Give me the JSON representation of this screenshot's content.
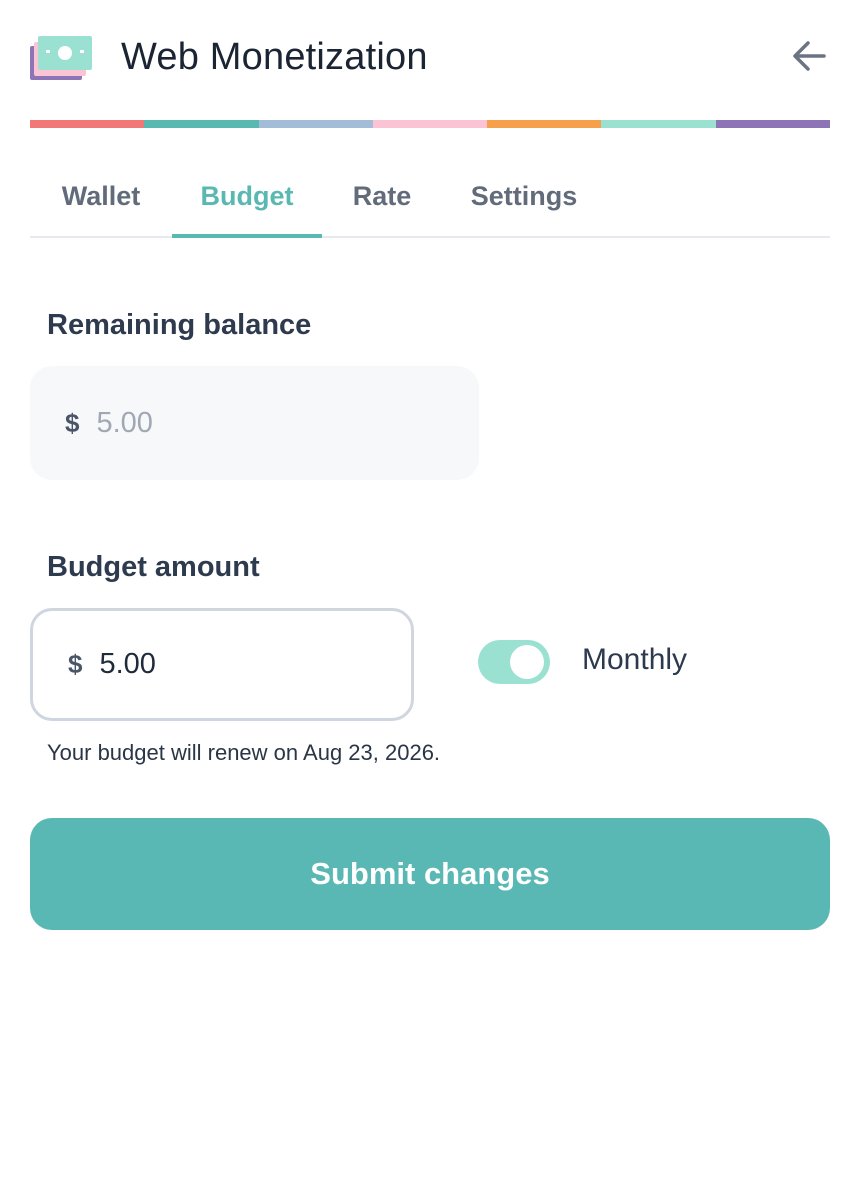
{
  "app": {
    "title": "Web Monetization",
    "logo_icon": "money-bill-icon",
    "back_icon": "arrow-left-icon"
  },
  "stripe_colors": [
    "#f27878",
    "#5ab8b2",
    "#a3bdd8",
    "#fbc4d4",
    "#f6a04d",
    "#9be1d1",
    "#8c74b7"
  ],
  "tabs": [
    {
      "label": "Wallet",
      "active": false
    },
    {
      "label": "Budget",
      "active": true
    },
    {
      "label": "Rate",
      "active": false
    },
    {
      "label": "Settings",
      "active": false
    }
  ],
  "remaining": {
    "label": "Remaining balance",
    "currency": "$",
    "value": "5.00"
  },
  "budget": {
    "label": "Budget amount",
    "currency": "$",
    "value": "5.00",
    "toggle_label": "Monthly",
    "toggle_on": true,
    "renew_text": "Your budget will renew on Aug 23, 2026."
  },
  "submit_label": "Submit changes",
  "colors": {
    "accent": "#5ab8b2",
    "toggle": "#9be1d1",
    "button": "#5ab8b4"
  }
}
